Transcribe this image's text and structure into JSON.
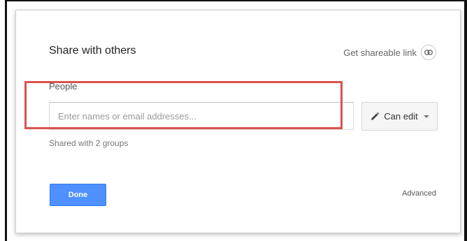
{
  "dialog": {
    "title": "Share with others",
    "shareable_link_label": "Get shareable link",
    "link_icon": "link-icon"
  },
  "people": {
    "label": "People",
    "input_value": "",
    "input_placeholder": "Enter names or email addresses...",
    "shared_with_text": "Shared with 2 groups"
  },
  "permission": {
    "icon": "pencil-icon",
    "label": "Can edit"
  },
  "footer": {
    "done_label": "Done",
    "advanced_label": "Advanced"
  },
  "colors": {
    "primary_button": "#4d90fe",
    "highlight_border": "#d9534f"
  }
}
